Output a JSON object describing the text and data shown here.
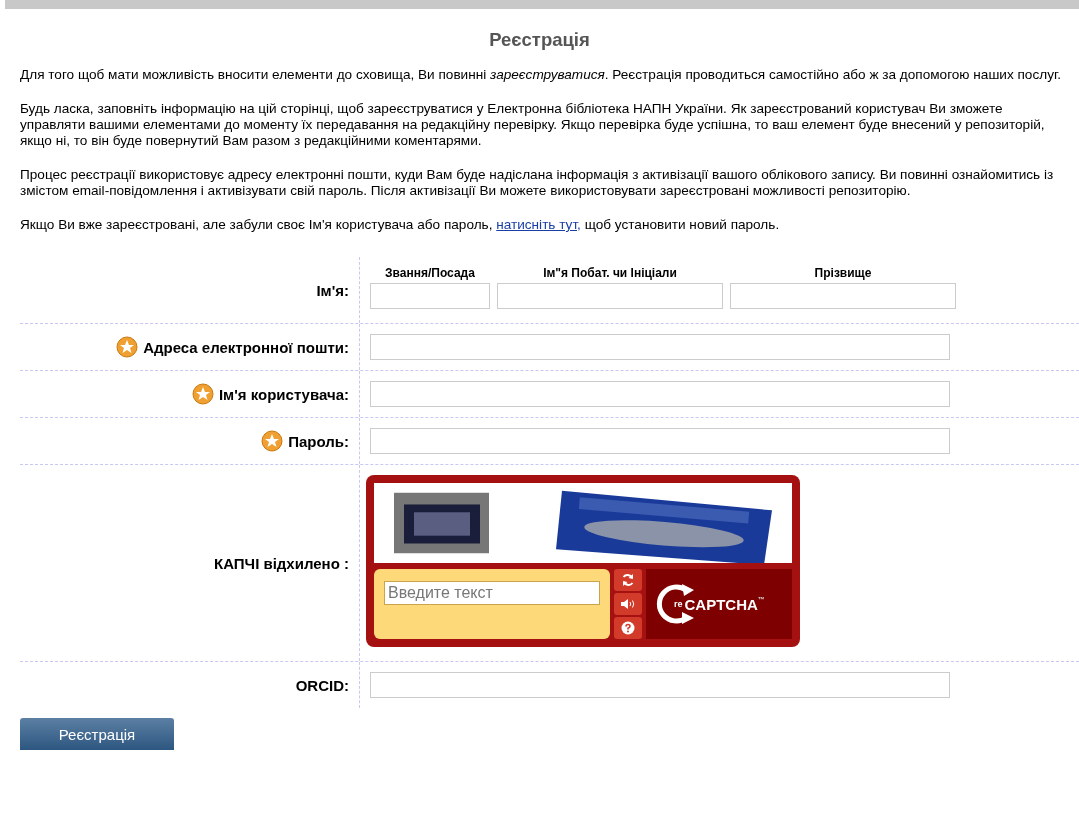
{
  "title": "Реєстрація",
  "paragraphs": [
    {
      "text": "Для того щоб мати можливість вносити елементи до сховища, Ви повинні *зареєструватися*. Реєстрація проводиться самостійно або ж за допомогою наших послуг."
    },
    {
      "text": "Будь ласка, заповніть інформацію на цій сторінці, щоб зареєструватися у Електронна бібліотека НАПН України. Як зареєстрований користувач Ви зможете управляти вашими елементами до моменту їх передавання на редакційну перевірку. Якщо перевірка буде успішна, то ваш елемент буде внесений у репозиторій, якщо ні, то він буде повернутий Вам разом з редакційними коментарями."
    },
    {
      "text": "Процес реєстрації використовує адресу електронні пошти, куди Вам буде надіслана інформація з активізації вашого облікового запису. Ви повинні ознайомитись із змістом email-повідомлення і активізувати свій пароль. Після активізації Ви можете використовувати зареєстровані можливості репозиторію."
    }
  ],
  "reset_paragraph": {
    "before": "Якщо Ви вже зареєстровані, але забули своє Ім'я користувача або пароль, ",
    "link": "натисніть тут,",
    "after": " щоб установити новий пароль."
  },
  "form": {
    "rows": [
      {
        "kind": "name",
        "label": "Ім'я:",
        "required": false,
        "subfields": [
          {
            "label": "Звання/Посада"
          },
          {
            "label": "Ім\"я Побат. чи Ініціали"
          },
          {
            "label": "Прізвище"
          }
        ]
      },
      {
        "kind": "text",
        "label": "Адреса електронної пошти:",
        "required": true
      },
      {
        "kind": "text",
        "label": "Ім'я користувача:",
        "required": true
      },
      {
        "kind": "text",
        "label": "Пароль:",
        "required": true
      },
      {
        "kind": "captcha",
        "label": "КАПЧІ відхилено :",
        "required": false,
        "captcha": {
          "placeholder": "Введите текст",
          "logo": {
            "prefix": "re",
            "name": "CAPTCHA",
            "mark": "™"
          }
        }
      },
      {
        "kind": "text",
        "label": "ORCID:",
        "required": false
      }
    ]
  },
  "submit": "Реєстрація"
}
